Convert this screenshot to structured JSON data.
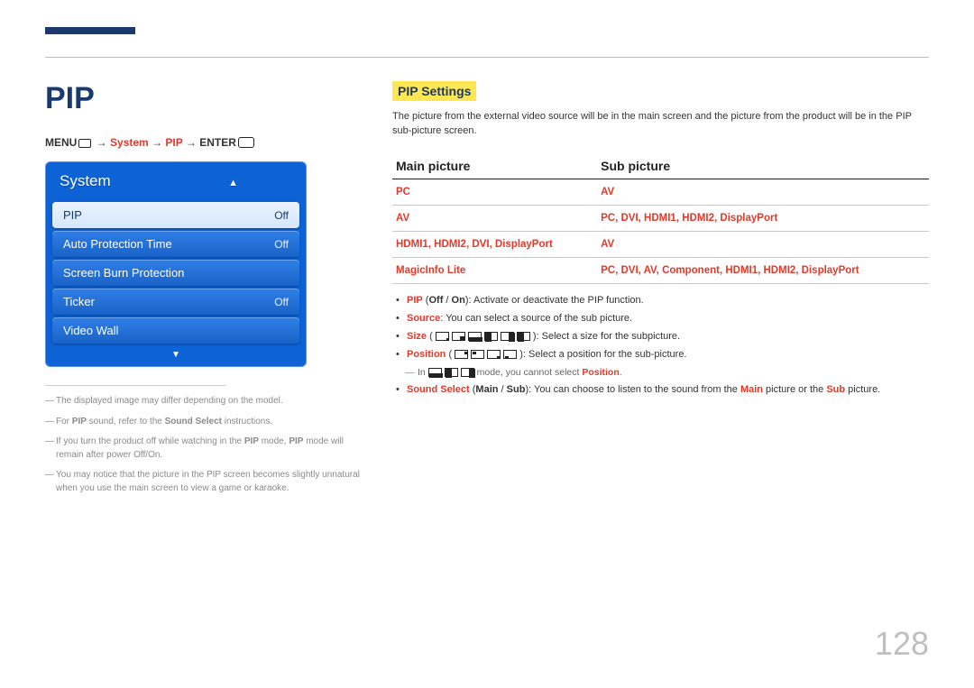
{
  "page_number": "128",
  "title": "PIP",
  "breadcrumb": {
    "menu": "MENU",
    "system": "System",
    "pip": "PIP",
    "enter": "ENTER"
  },
  "osd": {
    "title": "System",
    "rows": [
      {
        "label": "PIP",
        "value": "Off",
        "selected": true
      },
      {
        "label": "Auto Protection Time",
        "value": "Off",
        "selected": false
      },
      {
        "label": "Screen Burn Protection",
        "value": "",
        "selected": false
      },
      {
        "label": "Ticker",
        "value": "Off",
        "selected": false
      },
      {
        "label": "Video Wall",
        "value": "",
        "selected": false
      }
    ]
  },
  "notes": [
    "The displayed image may differ depending on the model.",
    "For PIP sound, refer to the Sound Select instructions.",
    "If you turn the product off while watching in the PIP mode, PIP mode will remain after power Off/On.",
    "You may notice that the picture in the PIP screen becomes slightly unnatural when you use the main screen to view a game or karaoke."
  ],
  "settings_heading": "PIP Settings",
  "settings_intro": "The picture from the external video source will be in the main screen and the picture from the product will be in the PIP sub-picture screen.",
  "table": {
    "headers": [
      "Main picture",
      "Sub picture"
    ],
    "rows": [
      [
        "PC",
        "AV"
      ],
      [
        "AV",
        "PC, DVI, HDMI1, HDMI2, DisplayPort"
      ],
      [
        "HDMI1, HDMI2, DVI, DisplayPort",
        "AV"
      ],
      [
        "MagicInfo Lite",
        "PC, DVI, AV, Component, HDMI1, HDMI2, DisplayPort"
      ]
    ]
  },
  "bullets": [
    {
      "label": "PIP",
      "emph": "(Off / On)",
      "text": ": Activate or deactivate the PIP function."
    },
    {
      "label": "Source",
      "emph": "",
      "text": ": You can select a source of the sub picture."
    },
    {
      "label": "Size",
      "emph": "",
      "text": ": Select a size for the subpicture."
    },
    {
      "label": "Position",
      "emph": "",
      "text": ": Select a position for the sub-picture."
    },
    {
      "sub": true,
      "text_before": "In ",
      "text_after": " mode, you cannot select ",
      "emph_end": "Position",
      "tail": "."
    },
    {
      "label": "Sound Select",
      "emph": "(Main / Sub)",
      "text": ": You can choose to listen to the sound from the ",
      "emph_mid1": "Main",
      "text2": " picture or the ",
      "emph_mid2": "Sub",
      "text3": " picture."
    }
  ]
}
